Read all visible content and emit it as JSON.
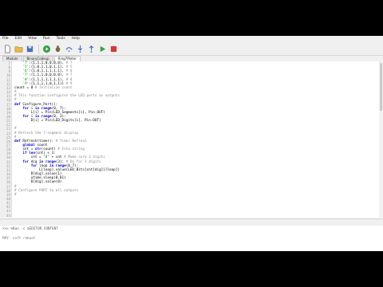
{
  "menu": [
    "File",
    "Edit",
    "View",
    "Run",
    "Tools",
    "Help"
  ],
  "tabs": [
    "Module",
    "BinaryCodeup",
    "Ring7Meter"
  ],
  "gutter": [
    "7",
    "8",
    "9",
    "10",
    "11",
    "12",
    "13",
    "14",
    "15",
    "16",
    "17",
    "18",
    "19",
    "20",
    "21",
    "22",
    "23",
    "24",
    "25",
    "26",
    "27",
    "28",
    "29",
    "30",
    "31",
    "32",
    "33",
    "34",
    "35",
    "36",
    "37",
    "38",
    "39",
    "40",
    "41",
    "42",
    "43",
    "44"
  ],
  "lines": [
    "    '7':(1,1,1,0,0,0,0), # 7",
    "    '5':(1,0,1,1,0,1,1), # 5",
    "    '6':(1,0,1,1,1,1,1), # 6",
    "    '7':(1,1,1,0,0,0,0), # 7",
    "    '8':(1,1,1,1,1,1,1), # 8",
    "    '9':(1,1,1,1,0,1,1)} # 9",
    "count = 0 # Initialize count",
    "#",
    "# This function configures the LED ports as outputs",
    "#",
    "def Configure_Port():",
    "    for i in range(0, 7):",
    "        L[i] = Pin(LED_Segments[i], Pin.OUT)",
    "    for i in range(0, 3):",
    "        D[i] = Pin(LED_Digits[i], Pin.OUT)",
    "",
    "#",
    "# Refresh the 7-segment display",
    "#",
    "def Refresh(timer): # Timer Refresh",
    "    global count",
    "    cnt = str(count) # Into string",
    "    if len(cnt) < 3:",
    "        cnt = \"0\" + cnt # Make sure 3 digits",
    "    for dig in range(3): # Do for 3 digits",
    "        for loop in range(0,7):",
    "            L[loop].value(LED_Bits[cnt[dig]][loop])",
    "        D[dig].value(1)",
    "        utime.sleep(0.01)",
    "        D[dig].value(0)",
    "#",
    "# Configure PORT to all outputs",
    "#"
  ],
  "shell": {
    "title": "Shell",
    "prompt_line": ">>> %Run -c $EDITOR_CONTENT",
    "output_line": "MPY: soft reboot"
  },
  "colors": {
    "keyword": "#0000cc",
    "comment": "#888888",
    "string": "#008800",
    "number": "#cc4400"
  }
}
